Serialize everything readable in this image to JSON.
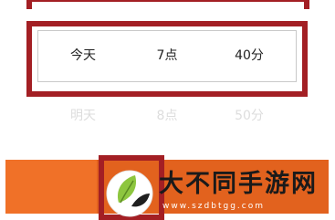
{
  "picker": {
    "selected_row": {
      "day": "今天",
      "hour": "7点",
      "minute": "40分"
    },
    "next_row": {
      "day": "明天",
      "hour": "8点",
      "minute": "50分"
    }
  },
  "watermark": {
    "title": "大不同手游网",
    "url": "www.szdbtgg.com"
  },
  "colors": {
    "highlight": "#a31f24",
    "confirm_bar": "#f07128",
    "logo_circle": "#ffffff",
    "logo_leaf": "#8dc63f"
  }
}
